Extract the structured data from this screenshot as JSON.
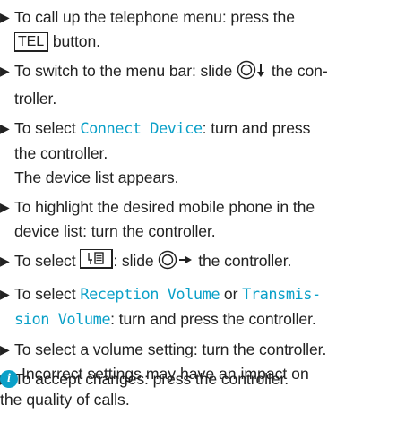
{
  "steps": [
    {
      "pre": "To call up the telephone menu: press the",
      "key": "TEL",
      "post": "button."
    },
    {
      "pre": "To switch to the menu bar: slide",
      "post1": "the con-",
      "post2": "troller."
    },
    {
      "pre": "To select",
      "hl": "Connect Device",
      "post1": ": turn and press",
      "post2": "the controller.",
      "extra": "The device list appears."
    },
    {
      "line1": "To highlight the desired mobile phone in the",
      "line2": "device list: turn the controller."
    },
    {
      "pre": "To select",
      "mid": ": slide",
      "post": "the controller."
    },
    {
      "pre": "To select",
      "hl1": "Reception Volume",
      "or": "or",
      "hl2a": "Transmis-",
      "hl2b": "sion Volume",
      "post": ": turn and press the controller."
    },
    {
      "text": "To select a volume setting: turn the controller."
    },
    {
      "text": "To accept changes: press the controller."
    }
  ],
  "note": {
    "icon": "info-icon",
    "line1": "Incorrect settings may have an impact on",
    "line2": "the quality of calls."
  },
  "colors": {
    "highlight": "#0aa0c8",
    "text": "#222222"
  }
}
